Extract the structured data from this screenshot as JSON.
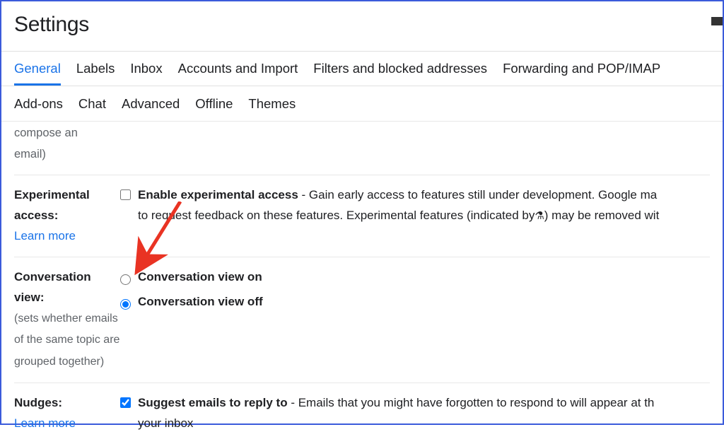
{
  "page_title": "Settings",
  "tabs_row1": [
    {
      "label": "General",
      "active": true
    },
    {
      "label": "Labels",
      "active": false
    },
    {
      "label": "Inbox",
      "active": false
    },
    {
      "label": "Accounts and Import",
      "active": false
    },
    {
      "label": "Filters and blocked addresses",
      "active": false
    },
    {
      "label": "Forwarding and POP/IMAP",
      "active": false
    }
  ],
  "tabs_row2": [
    {
      "label": "Add-ons"
    },
    {
      "label": "Chat"
    },
    {
      "label": "Advanced"
    },
    {
      "label": "Offline"
    },
    {
      "label": "Themes"
    }
  ],
  "partial_top_text1": "compose an",
  "partial_top_text2": "email)",
  "experimental": {
    "label": "Experimental access:",
    "learn_more": "Learn more",
    "checkbox_checked": false,
    "bold": "Enable experimental access",
    "desc1": " - Gain early access to features still under development. Google ma",
    "desc2": "to request feedback on these features. Experimental features (indicated by",
    "desc3": ") may be removed wit"
  },
  "conversation": {
    "label": "Conversation view:",
    "subtext": "(sets whether emails of the same topic are grouped together)",
    "option_on": "Conversation view on",
    "option_off": "Conversation view off",
    "selected": "off"
  },
  "nudges": {
    "label": "Nudges:",
    "learn_more": "Learn more",
    "checkbox_checked": true,
    "bold": "Suggest emails to reply to",
    "desc1": " - Emails that you might have forgotten to respond to will appear at th",
    "desc2": "your inbox"
  }
}
